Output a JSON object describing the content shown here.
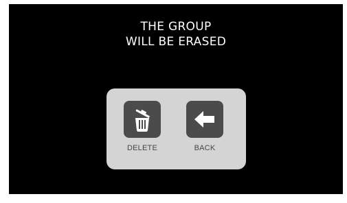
{
  "dialog": {
    "message_line1": "THE GROUP",
    "message_line2": "WILL BE ERASED",
    "actions": [
      {
        "label": "DELETE",
        "icon": "trash-icon"
      },
      {
        "label": "BACK",
        "icon": "arrow-left-icon"
      }
    ]
  },
  "colors": {
    "screen_background": "#000000",
    "message_text": "#ffffff",
    "panel_background": "#d4d4d4",
    "tile_background": "#4b4b4b",
    "label_text": "#454545"
  }
}
